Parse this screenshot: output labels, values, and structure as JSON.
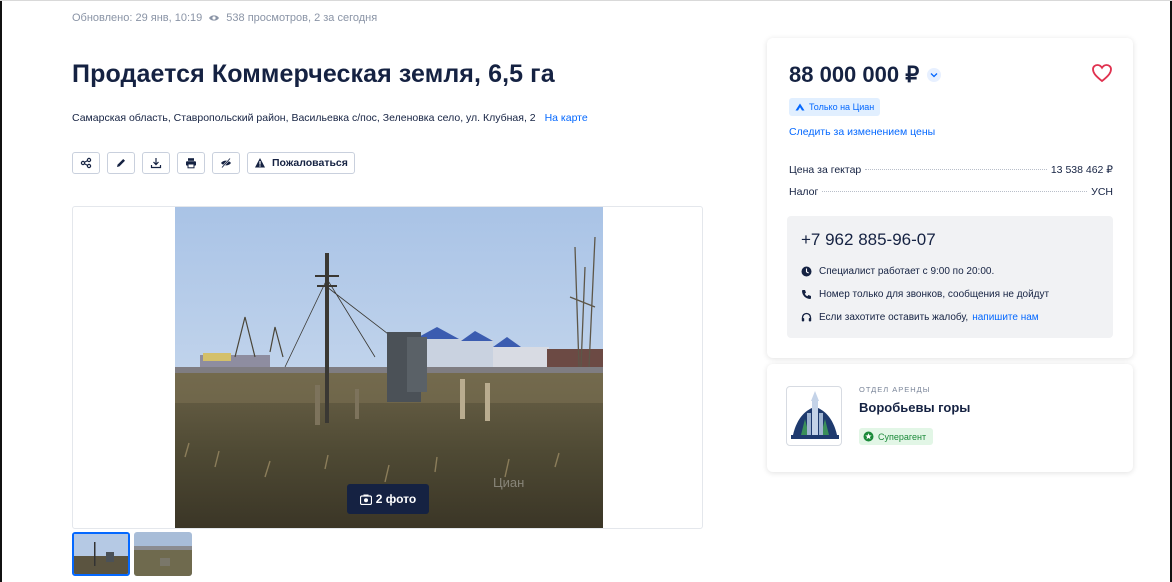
{
  "meta": {
    "updated": "Обновлено: 29 янв, 10:19",
    "views": "538 просмотров, 2 за сегодня"
  },
  "listing": {
    "title": "Продается Коммерческая земля, 6,5 га",
    "address": "Самарская область, Ставропольский район, Васильевка с/пос, Зеленовка село, ул. Клубная, 2",
    "map_link": "На карте"
  },
  "actions": {
    "share_icon": "share-icon",
    "edit_icon": "pencil-icon",
    "download_icon": "download-icon",
    "print_icon": "printer-icon",
    "hide_icon": "hide-icon",
    "complain_label": "Пожаловаться"
  },
  "gallery": {
    "photo_count": "2 фото",
    "watermark": "Циан"
  },
  "price_card": {
    "price": "88 000 000 ₽",
    "only_on_label": "Только на Циан",
    "follow_link": "Следить за изменением цены",
    "rows": [
      {
        "key": "Цена за гектар",
        "value": "13 538 462 ₽"
      },
      {
        "key": "Налог",
        "value": "УСН"
      }
    ],
    "phone": "+7 962 885-96-07",
    "notes": {
      "hours": "Специалист работает с 9:00 по 20:00.",
      "calls_only": "Номер только для звонков, сообщения не дойдут",
      "complaint_text": "Если захотите оставить жалобу,",
      "complaint_link": "напишите нам"
    }
  },
  "agent": {
    "department": "ОТДЕЛ АРЕНДЫ",
    "name": "Воробьевы горы",
    "badge": "Суперагент"
  },
  "colors": {
    "accent": "#0468ff",
    "text": "#152242",
    "heart": "#e0314f",
    "super_green": "#1b8a3a"
  }
}
